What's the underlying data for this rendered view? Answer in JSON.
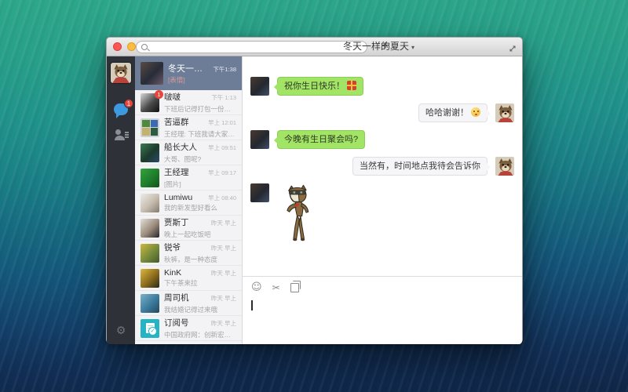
{
  "window": {
    "title": "冬天一样的夏天",
    "title_dropdown": "▾",
    "search": {
      "placeholder": "",
      "value": ""
    },
    "new_chat_label": "+",
    "traffic_lights": [
      "close",
      "minimize",
      "zoom"
    ]
  },
  "nav": {
    "chat_badge": "1",
    "gear_glyph": "⚙",
    "items": [
      "chats",
      "contacts",
      "settings"
    ]
  },
  "chat_list": {
    "items": [
      {
        "name": "冬天一样的夏天",
        "time": "下午1:38",
        "preview": "[表情]",
        "selected": true,
        "avatar": {
          "kind": "photo",
          "colors": [
            "#5a4a44",
            "#272c38",
            "#6a5a68"
          ]
        }
      },
      {
        "name": "啵啵",
        "time": "下午 1:13",
        "preview": "下班后记得打包一份给我哦",
        "badge": "1",
        "avatar": {
          "kind": "photo",
          "colors": [
            "#d8d8d8",
            "#4a4a4a",
            "#101010"
          ]
        }
      },
      {
        "name": "苦逼群",
        "time": "早上 12:01",
        "preview": "王经理: 下班我请大家吃饭",
        "avatar": {
          "kind": "group",
          "colors": [
            "#4e8a3c",
            "#3a6ab0",
            "#c4b26c",
            "#2e5a40"
          ]
        }
      },
      {
        "name": "船长大人",
        "time": "早上 09:51",
        "preview": "大哥、图呢?",
        "avatar": {
          "kind": "photo",
          "colors": [
            "#3e7a52",
            "#1c3a2c",
            "#2c4a68"
          ]
        }
      },
      {
        "name": "王经理",
        "time": "早上 09:17",
        "preview": "[图片]",
        "avatar": {
          "kind": "photo",
          "colors": [
            "#33a33e",
            "#1f7e2c",
            "#11531c"
          ]
        }
      },
      {
        "name": "Lumiwu",
        "time": "早上 08:40",
        "preview": "我的新发型好看么",
        "avatar": {
          "kind": "photo",
          "colors": [
            "#ecebe8",
            "#c6bcae",
            "#84796e"
          ]
        }
      },
      {
        "name": "贾斯丁",
        "time": "昨天 早上",
        "preview": "晚上一起吃饭吧",
        "avatar": {
          "kind": "photo",
          "colors": [
            "#e2dfd8",
            "#9a8a7a",
            "#26262a"
          ]
        }
      },
      {
        "name": "锐爷",
        "time": "昨天 早上",
        "preview": "秋裤，是一种态度",
        "avatar": {
          "kind": "photo",
          "colors": [
            "#ccb83e",
            "#768a3a",
            "#455a2a"
          ]
        }
      },
      {
        "name": "KinK",
        "time": "昨天 早上",
        "preview": "下午茶来拉",
        "avatar": {
          "kind": "photo",
          "colors": [
            "#dcb83c",
            "#8a6a1c",
            "#2a2a18"
          ]
        }
      },
      {
        "name": "周司机",
        "time": "昨天 早上",
        "preview": "我结婚记得过来哦",
        "avatar": {
          "kind": "photo",
          "colors": [
            "#7cb2ca",
            "#3a7a9c",
            "#27485a"
          ]
        }
      },
      {
        "name": "订阅号",
        "time": "昨天 早上",
        "preview": "中国政府网：创新宏观调控：中…",
        "avatar": {
          "kind": "subscription",
          "colors": [
            "#26b4c4"
          ]
        }
      }
    ]
  },
  "conversation": {
    "peer_avatar": {
      "kind": "photo",
      "colors": [
        "#4a3a33",
        "#23282f",
        "#445068"
      ]
    },
    "messages": [
      {
        "side": "in",
        "kind": "text",
        "text": "祝你生日快乐！",
        "emoji": "gift"
      },
      {
        "side": "out",
        "kind": "text",
        "text": "哈哈谢谢！",
        "emoji": "kiss-smiley"
      },
      {
        "side": "in",
        "kind": "text",
        "text": "今晚有生日聚会吗?"
      },
      {
        "side": "out",
        "kind": "text",
        "text": "当然有，时间地点我待会告诉你"
      },
      {
        "side": "in",
        "kind": "sticker",
        "sticker": "dancing-horse-sticker"
      }
    ]
  },
  "composer": {
    "icons": [
      "emoji-picker",
      "screenshot-scissors",
      "send-file"
    ],
    "smiley_glyph": "☺",
    "scissors_glyph": "✂",
    "input_value": ""
  }
}
